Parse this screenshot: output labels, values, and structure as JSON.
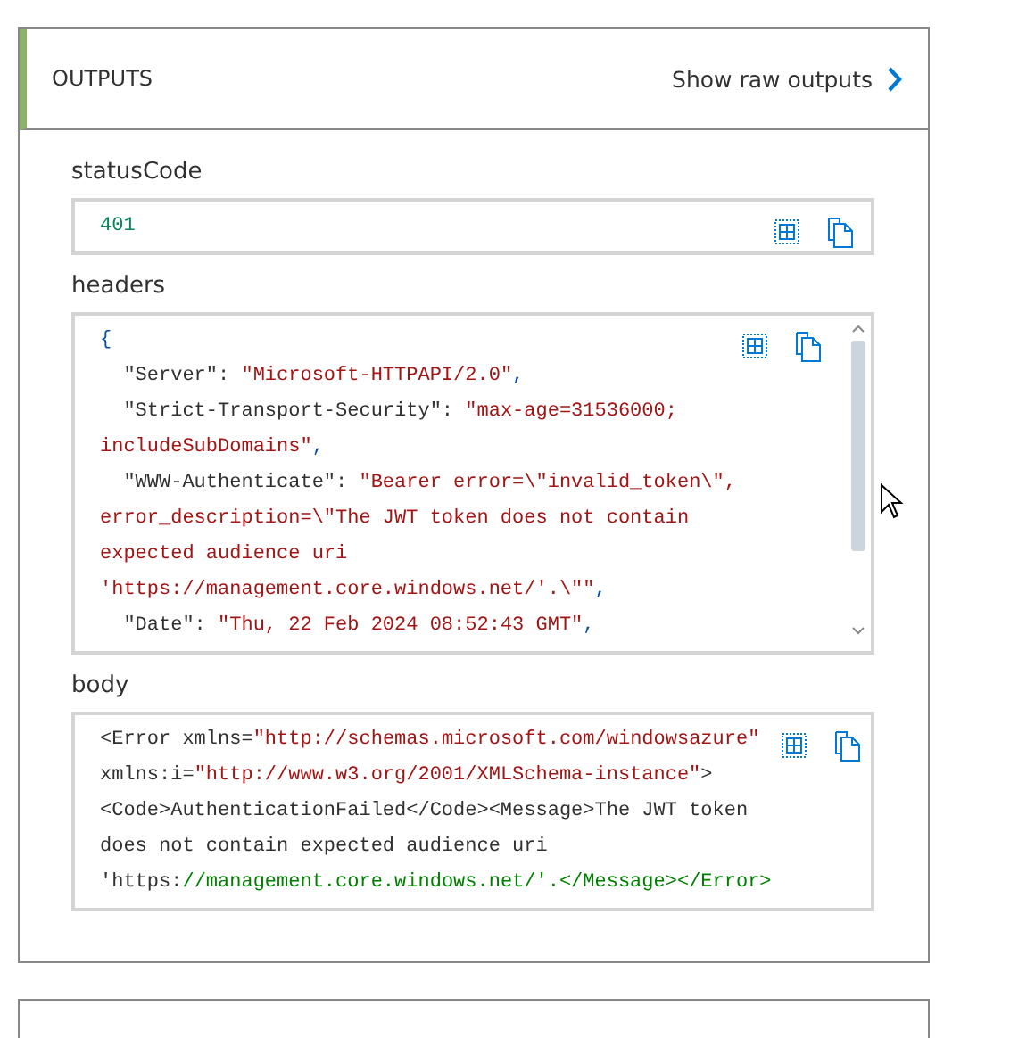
{
  "section": {
    "title": "OUTPUTS",
    "action": "Show raw outputs"
  },
  "fields": [
    {
      "label": "statusCode",
      "scroll": false,
      "lines": [
        [
          {
            "kind": "number",
            "text": "401"
          }
        ]
      ]
    },
    {
      "label": "headers",
      "scroll": true,
      "lines": [
        [
          {
            "kind": "punct",
            "text": "{"
          }
        ],
        [
          {
            "kind": "key",
            "text": "  \"Server\": "
          },
          {
            "kind": "string",
            "text": "\"Microsoft-HTTPAPI/2.0\""
          },
          {
            "kind": "punct",
            "text": ","
          }
        ],
        [
          {
            "kind": "key",
            "text": "  \"Strict-Transport-Security\": "
          },
          {
            "kind": "string",
            "text": "\"max-age=31536000;"
          }
        ],
        [
          {
            "kind": "string",
            "text": "includeSubDomains\""
          },
          {
            "kind": "punct",
            "text": ","
          }
        ],
        [
          {
            "kind": "key",
            "text": "  \"WWW-Authenticate\": "
          },
          {
            "kind": "string",
            "text": "\"Bearer error=\\\"invalid_token\\\","
          }
        ],
        [
          {
            "kind": "string",
            "text": "error_description=\\\"The JWT token does not contain"
          }
        ],
        [
          {
            "kind": "string",
            "text": "expected audience uri"
          }
        ],
        [
          {
            "kind": "string",
            "text": "'https://management.core.windows.net/'.\\\"\""
          },
          {
            "kind": "punct",
            "text": ","
          }
        ],
        [
          {
            "kind": "key",
            "text": "  \"Date\": "
          },
          {
            "kind": "string",
            "text": "\"Thu, 22 Feb 2024 08:52:43 GMT\""
          },
          {
            "kind": "punct",
            "text": ","
          }
        ]
      ]
    },
    {
      "label": "body",
      "scroll": false,
      "lines": [
        [
          {
            "kind": "text",
            "text": "<Error xmlns="
          },
          {
            "kind": "string",
            "text": "\"http://schemas.microsoft.com/windowsazure\""
          }
        ],
        [
          {
            "kind": "text",
            "text": "xmlns:i="
          },
          {
            "kind": "string",
            "text": "\"http://www.w3.org/2001/XMLSchema-instance\""
          },
          {
            "kind": "text",
            "text": ">"
          }
        ],
        [
          {
            "kind": "text",
            "text": "<Code>AuthenticationFailed</Code><Message>The JWT token"
          }
        ],
        [
          {
            "kind": "text",
            "text": "does not contain expected audience uri"
          }
        ],
        [
          {
            "kind": "text",
            "text": "'https:"
          },
          {
            "kind": "comment",
            "text": "//management.core.windows.net/'.</Message></Error>"
          }
        ]
      ]
    }
  ]
}
